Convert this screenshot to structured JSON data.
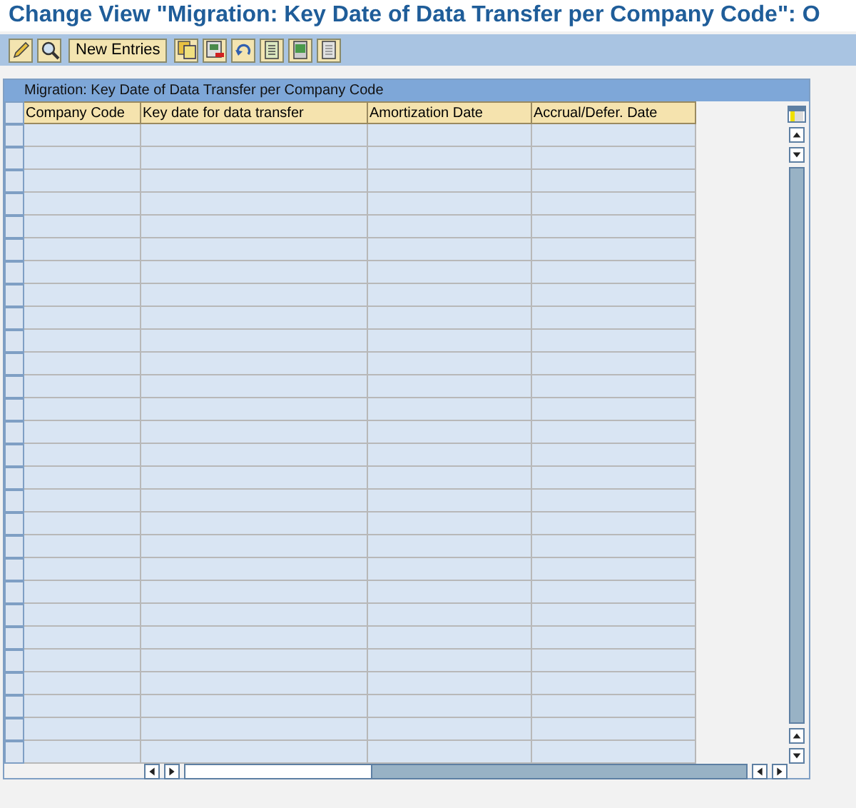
{
  "window": {
    "title": "Change View \"Migration: Key Date of Data Transfer per Company Code\": O"
  },
  "toolbar": [
    {
      "kind": "pencil"
    },
    {
      "kind": "glasses"
    },
    {
      "kind": "text",
      "label": "New Entries"
    },
    {
      "kind": "copy"
    },
    {
      "kind": "delete"
    },
    {
      "kind": "undo"
    },
    {
      "kind": "select-all"
    },
    {
      "kind": "select-block"
    },
    {
      "kind": "deselect"
    }
  ],
  "table": {
    "title": "Migration: Key Date of Data Transfer per Company Code",
    "columns": [
      "Company Code",
      "Key date for data transfer",
      "Amortization Date",
      "Accrual/Defer. Date"
    ],
    "rows": [
      {
        "selected": false
      },
      {
        "selected": false
      },
      {
        "selected": false
      },
      {
        "selected": false
      },
      {
        "selected": false
      },
      {
        "selected": false
      },
      {
        "selected": false
      },
      {
        "selected": false
      },
      {
        "selected": false
      },
      {
        "selected": false
      },
      {
        "selected": false
      },
      {
        "selected": false
      },
      {
        "selected": false
      },
      {
        "selected": false
      },
      {
        "selected": false
      },
      {
        "selected": false
      },
      {
        "selected": false
      },
      {
        "selected": false
      },
      {
        "selected": false
      },
      {
        "selected": false
      },
      {
        "selected": false
      },
      {
        "selected": false
      },
      {
        "selected": false
      },
      {
        "selected": false
      },
      {
        "selected": false
      },
      {
        "selected": false
      },
      {
        "selected": false
      },
      {
        "selected": false
      }
    ]
  }
}
